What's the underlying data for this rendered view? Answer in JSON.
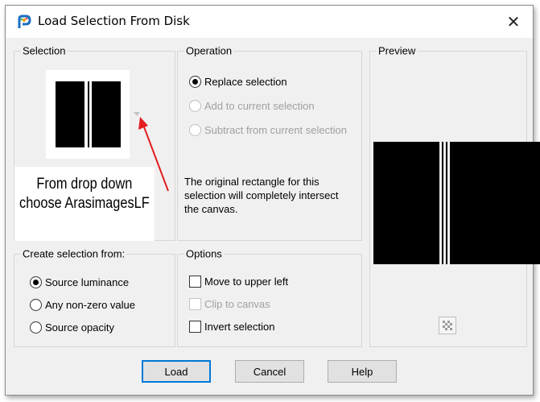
{
  "window": {
    "title": "Load Selection From Disk",
    "close_glyph": "✕"
  },
  "selection": {
    "label": "Selection",
    "annotation_line1": "From drop down",
    "annotation_line2": "choose ArasimagesLF",
    "annotation_arrow_color": "#e41e1e"
  },
  "operation": {
    "label": "Operation",
    "options": [
      {
        "label": "Replace selection",
        "selected": true,
        "enabled": true
      },
      {
        "label": "Add to current selection",
        "selected": false,
        "enabled": false
      },
      {
        "label": "Subtract from current selection",
        "selected": false,
        "enabled": false
      }
    ],
    "description": "The original rectangle for this selection will completely intersect the canvas."
  },
  "preview": {
    "label": "Preview",
    "checker_icon": "checkerboard-icon"
  },
  "create_from": {
    "label": "Create selection from:",
    "options": [
      {
        "label": "Source luminance",
        "selected": true
      },
      {
        "label": "Any non-zero value",
        "selected": false
      },
      {
        "label": "Source opacity",
        "selected": false
      }
    ]
  },
  "options": {
    "label": "Options",
    "items": [
      {
        "label": "Move to upper left",
        "checked": false,
        "enabled": true
      },
      {
        "label": "Clip to canvas",
        "checked": false,
        "enabled": false
      },
      {
        "label": "Invert selection",
        "checked": false,
        "enabled": true
      }
    ]
  },
  "buttons": {
    "load": "Load",
    "cancel": "Cancel",
    "help": "Help"
  },
  "colors": {
    "accent": "#0078d7",
    "dialog_bg": "#f0f0f0",
    "annotation_arrow": "#e41e1e"
  }
}
